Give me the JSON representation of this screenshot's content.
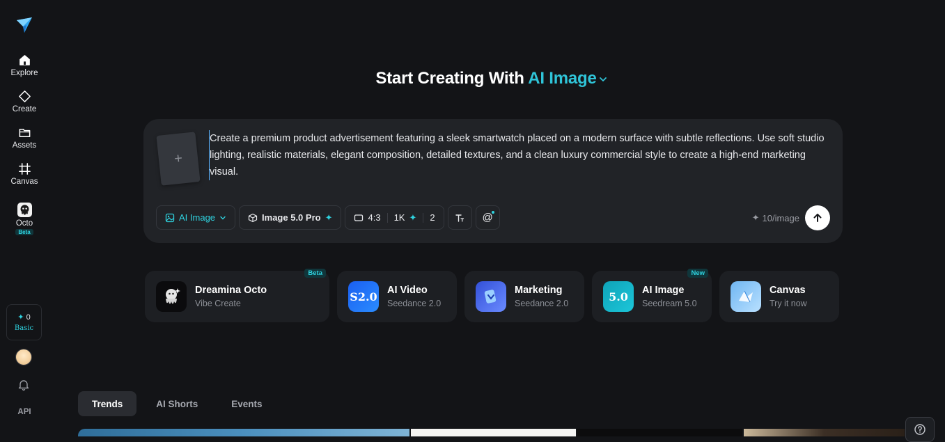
{
  "sidebar": {
    "logo_icon": "paper-plane-logo",
    "items": [
      {
        "label": "Explore",
        "icon": "home-icon"
      },
      {
        "label": "Create",
        "icon": "diamond-icon"
      },
      {
        "label": "Assets",
        "icon": "folder-icon"
      },
      {
        "label": "Canvas",
        "icon": "frame-icon"
      },
      {
        "label": "Octo",
        "icon": "octo-icon",
        "badge": "Beta"
      }
    ],
    "credits": {
      "value": "0",
      "plan": "Basic"
    },
    "api_label": "API"
  },
  "heading": {
    "prefix": "Start Creating With",
    "mode": "AI Image"
  },
  "prompt": {
    "text": "Create a premium product advertisement featuring a sleek smartwatch placed on a modern surface with subtle reflections. Use soft studio lighting, realistic materials, elegant composition, detailed textures, and a clean luxury commercial style to create a high-end marketing visual.",
    "upload_symbol": "+",
    "tools": {
      "mode_label": "AI Image",
      "model_label": "Image 5.0 Pro",
      "ratio": "4:3",
      "resolution": "1K",
      "count": "2"
    },
    "cost": "10/image"
  },
  "cards": [
    {
      "title": "Dreamina Octo",
      "subtitle": "Vibe Create",
      "badge": "Beta",
      "icon_text": ""
    },
    {
      "title": "AI Video",
      "subtitle": "Seedance 2.0",
      "badge": "",
      "icon_text": "S2.0"
    },
    {
      "title": "Marketing",
      "subtitle": "Seedance 2.0",
      "badge": "",
      "icon_text": ""
    },
    {
      "title": "AI Image",
      "subtitle": "Seedream 5.0",
      "badge": "New",
      "icon_text": "5.0"
    },
    {
      "title": "Canvas",
      "subtitle": "Try it now",
      "badge": "",
      "icon_text": ""
    }
  ],
  "tabs": [
    {
      "label": "Trends",
      "active": true
    },
    {
      "label": "AI Shorts",
      "active": false
    },
    {
      "label": "Events",
      "active": false
    }
  ],
  "colors": {
    "accent": "#2fc4d8",
    "background": "#131417",
    "panel": "#212327"
  }
}
